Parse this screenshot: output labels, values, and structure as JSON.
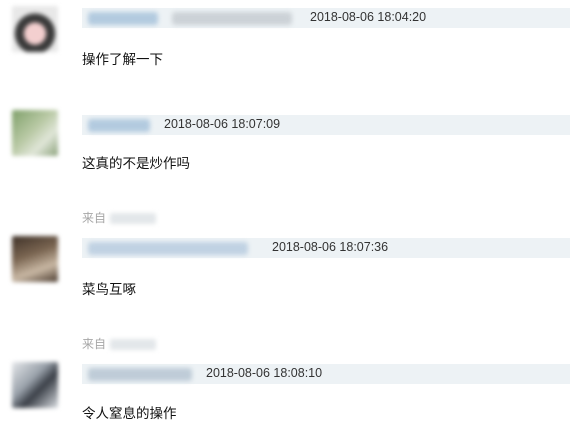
{
  "comments": [
    {
      "timestamp": "2018-08-06 18:04:20",
      "text": "操作了解一下"
    },
    {
      "timestamp": "2018-08-06 18:07:09",
      "text": "这真的不是炒作吗"
    },
    {
      "timestamp": "2018-08-06 18:07:36",
      "text": "菜鸟互啄",
      "source": "来自"
    },
    {
      "timestamp": "2018-08-06 18:08:10",
      "text": "令人窒息的操作",
      "source": "来自"
    }
  ]
}
